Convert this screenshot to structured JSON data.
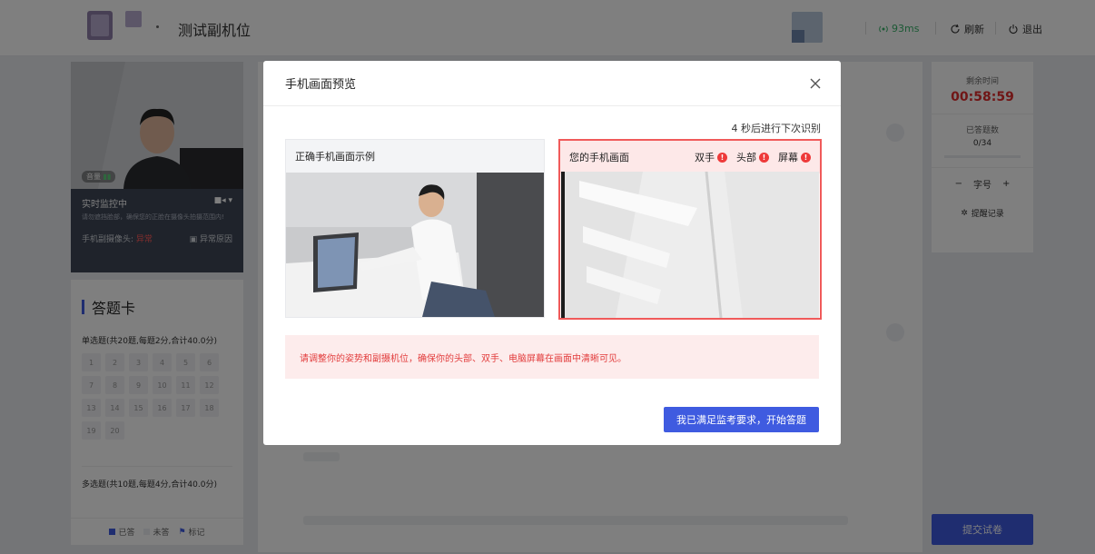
{
  "header": {
    "exam_title": "测试副机位",
    "network_latency": "93ms",
    "refresh_label": "刷新",
    "logout_label": "退出"
  },
  "camera": {
    "volume_label": "音量",
    "status_label": "实时监控中",
    "tip": "请勿遮挡脸部，确保您的正脸在摄像头拍摄范围内!",
    "phone_cam_label": "手机副摄像头:",
    "phone_cam_status": "异常",
    "abnormal_reason_label": "异常原因"
  },
  "answer_card": {
    "title": "答题卡",
    "section1_title": "单选题(共20题,每题2分,合计40.0分)",
    "section1_numbers": [
      "1",
      "2",
      "3",
      "4",
      "5",
      "6",
      "7",
      "8",
      "9",
      "10",
      "11",
      "12",
      "13",
      "14",
      "15",
      "16",
      "17",
      "18",
      "19",
      "20"
    ],
    "section2_title": "多选题(共10题,每题4分,合计40.0分)",
    "legend_answered": "已答",
    "legend_unanswered": "未答",
    "legend_marked": "标记"
  },
  "right_panel": {
    "remaining_label": "剩余时间",
    "remaining_time": "00:58:59",
    "answered_label": "已答题数",
    "answered_count": "0/34",
    "font_minus": "−",
    "font_label": "字号",
    "font_plus": "+",
    "remind_label": "提醒记录",
    "submit_label": "提交试卷"
  },
  "modal": {
    "title": "手机画面预览",
    "countdown_text": "4 秒后进行下次识别",
    "example_title": "正确手机画面示例",
    "your_screen_title": "您的手机画面",
    "status_items": [
      {
        "label": "双手",
        "state": "error"
      },
      {
        "label": "头部",
        "state": "error"
      },
      {
        "label": "屏幕",
        "state": "error"
      }
    ],
    "alert_text": "请调整你的姿势和副摄机位，确保你的头部、双手、电脑屏幕在画面中清晰可见。",
    "confirm_label": "我已满足监考要求，开始答题"
  },
  "colors": {
    "primary": "#3f5be0",
    "error": "#ee3a3a",
    "network_ok": "#39b36b"
  }
}
